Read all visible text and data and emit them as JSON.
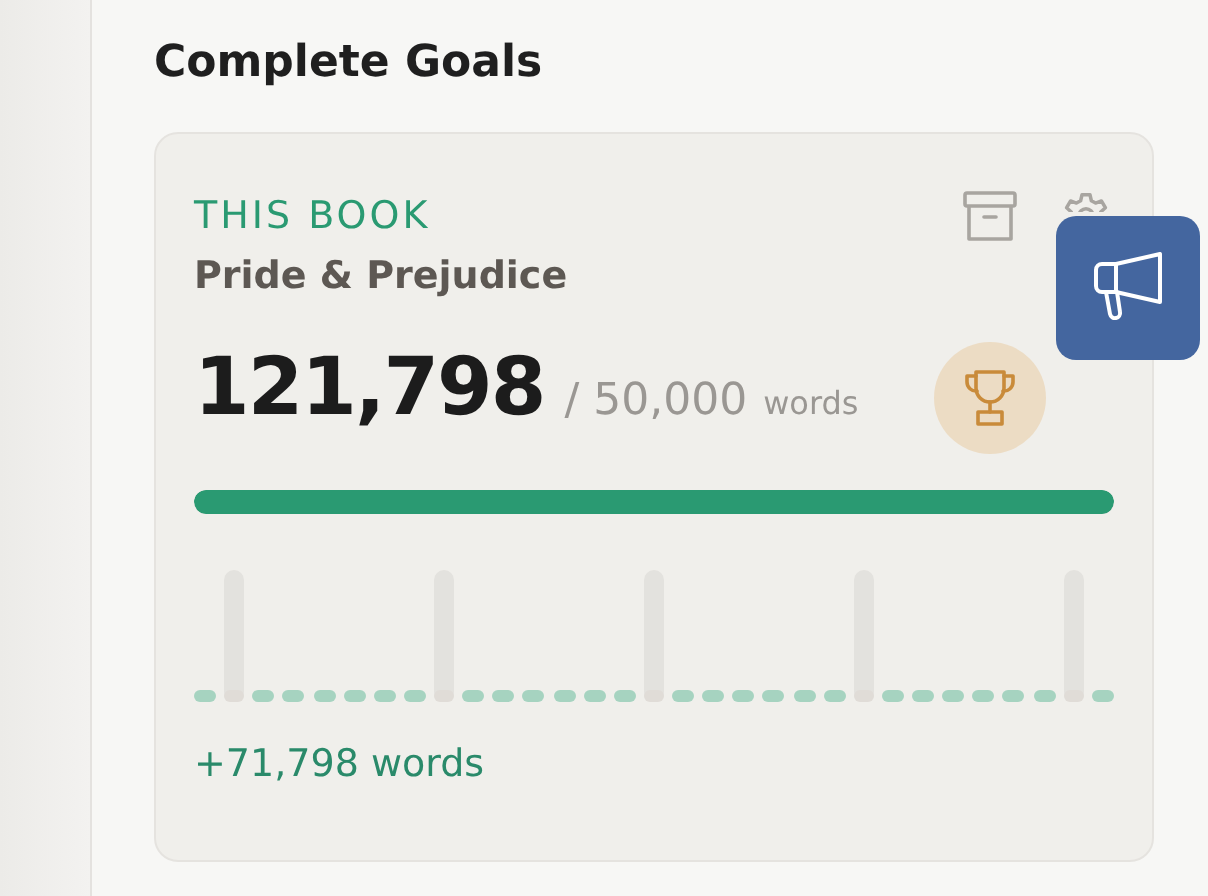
{
  "heading": "Complete Goals",
  "goal": {
    "label": "THIS BOOK",
    "title": "Pride & Prejudice",
    "count": "121,798",
    "target": "/ 50,000",
    "unit": "words",
    "level": 1,
    "change": "+71,798 words"
  }
}
